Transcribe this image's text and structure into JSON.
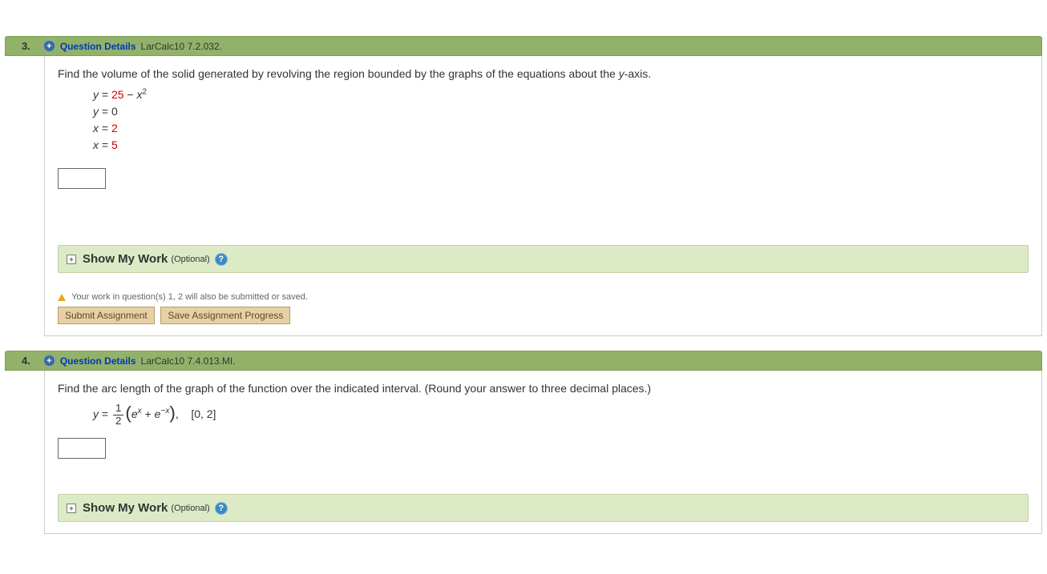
{
  "questions": [
    {
      "number": "3.",
      "details_label": "Question Details",
      "reference": "LarCalc10 7.2.032.",
      "prompt_pre": "Find the volume of the solid generated by revolving the region bounded by the graphs of the equations about the ",
      "prompt_axis": "y",
      "prompt_post": "-axis.",
      "eq1_lhs": "y",
      "eq1_const": "25",
      "eq1_minus": " − ",
      "eq1_var": "x",
      "eq1_exp": "2",
      "eq2_lhs": "y",
      "eq2_rhs": "0",
      "eq3_lhs": "x",
      "eq3_rhs": "2",
      "eq4_lhs": "x",
      "eq4_rhs": "5",
      "show_my_work": "Show My Work",
      "optional": "(Optional)",
      "warning": "Your work in question(s) 1, 2 will also be submitted or saved.",
      "submit_label": "Submit Assignment",
      "save_label": "Save Assignment Progress"
    },
    {
      "number": "4.",
      "details_label": "Question Details",
      "reference": "LarCalc10 7.4.013.MI.",
      "prompt": "Find the arc length of the graph of the function over the indicated interval. (Round your answer to three decimal places.)",
      "eq_lhs": "y",
      "frac_num": "1",
      "frac_den": "2",
      "e1": "e",
      "exp1": "x",
      "plus": " + ",
      "e2": "e",
      "exp2": "−x",
      "interval": "[0, 2]",
      "show_my_work": "Show My Work",
      "optional": "(Optional)"
    }
  ]
}
